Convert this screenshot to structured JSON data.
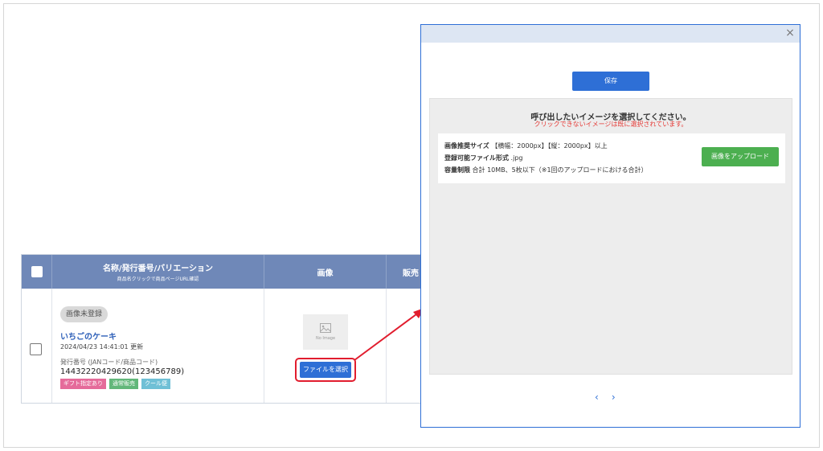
{
  "table": {
    "header": {
      "name_main": "名称/発行番号/バリエーション",
      "name_sub": "商品名クリックで商品ページURL確認",
      "image": "画像",
      "sale": "販売"
    },
    "row": {
      "image_status_badge": "画像未登録",
      "product_name": "いちごのケーキ",
      "updated": "2024/04/23 14:41:01 更新",
      "issue_label": "発行番号 (JANコード/商品コード)",
      "issue_number": "14432220429620(123456789)",
      "tags": [
        "ギフト指定あり",
        "通常販売",
        "クール便"
      ],
      "no_image_text": "No Image",
      "file_select_button": "ファイルを選択"
    }
  },
  "modal": {
    "close": "×",
    "save_button": "保存",
    "prompt": "呼び出したいイメージを選択してください。",
    "warning": "クリックできないイメージは既に選択されています。",
    "info": {
      "size_label": "画像推奨サイズ",
      "size_value": "【横幅：2000px】【縦：2000px】以上",
      "format_label": "登録可能ファイル形式",
      "format_value": ".jpg",
      "capacity_label": "容量制限",
      "capacity_value": "合計 10MB、5枚以下（※1回のアップロードにおける合計）"
    },
    "upload_button": "画像をアップロード",
    "pager": {
      "prev": "‹",
      "next": "›"
    }
  },
  "colors": {
    "table_header": "#6f88b8",
    "primary_button": "#2e6fd6",
    "upload_button": "#4caf50",
    "highlight_arrow": "#e11d2e",
    "warning_text": "#e53935"
  }
}
